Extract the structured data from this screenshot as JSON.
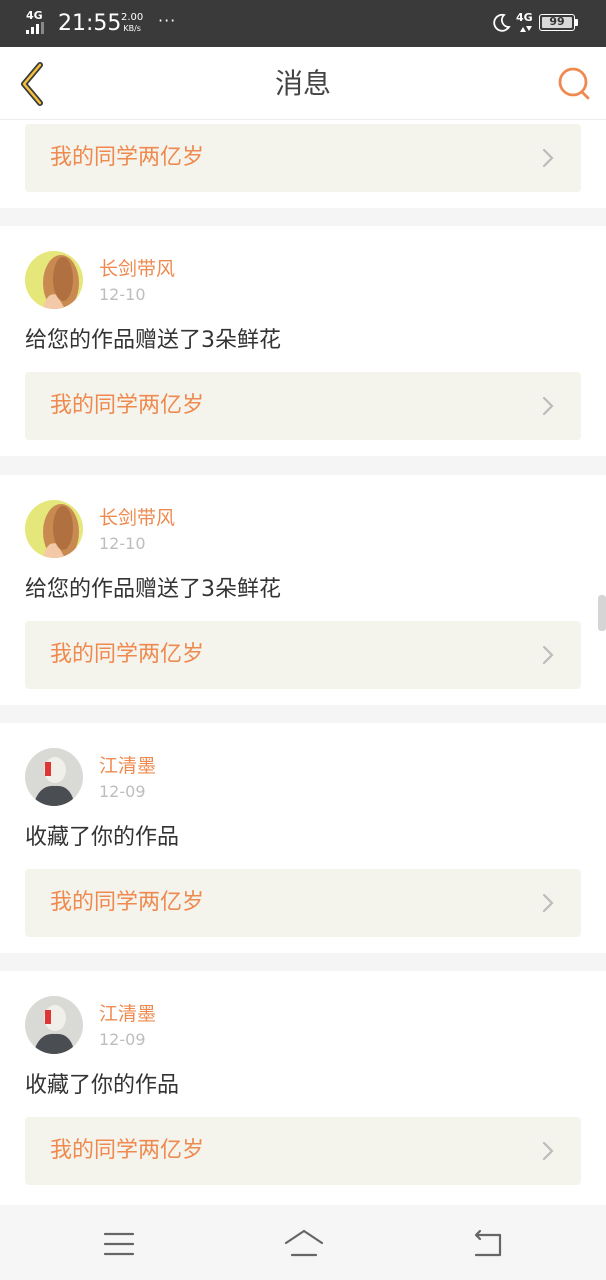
{
  "status_bar": {
    "network_left": "4G",
    "time": "21:55",
    "speed_value": "2.00",
    "speed_unit": "KB/s",
    "dots": "···",
    "network_right": "4G",
    "battery": "99",
    "icons": [
      "signal-icon",
      "moon-icon",
      "battery-icon"
    ]
  },
  "nav": {
    "title": "消息",
    "back_icon": "back-chevron-icon",
    "search_icon": "search-icon",
    "accent_color": "#ee8a4f"
  },
  "cards": [
    {
      "user": "",
      "date": "",
      "message": "",
      "work_title": "我的同学两亿岁"
    },
    {
      "user": "长剑带风",
      "date": "12-10",
      "message": "给您的作品赠送了3朵鲜花",
      "work_title": "我的同学两亿岁"
    },
    {
      "user": "长剑带风",
      "date": "12-10",
      "message": "给您的作品赠送了3朵鲜花",
      "work_title": "我的同学两亿岁"
    },
    {
      "user": "江清墨",
      "date": "12-09",
      "message": "收藏了你的作品",
      "work_title": "我的同学两亿岁"
    },
    {
      "user": "江清墨",
      "date": "12-09",
      "message": "收藏了你的作品",
      "work_title": "我的同学两亿岁"
    }
  ],
  "system_nav": {
    "icons": [
      "menu-icon",
      "home-icon",
      "back-icon"
    ]
  }
}
